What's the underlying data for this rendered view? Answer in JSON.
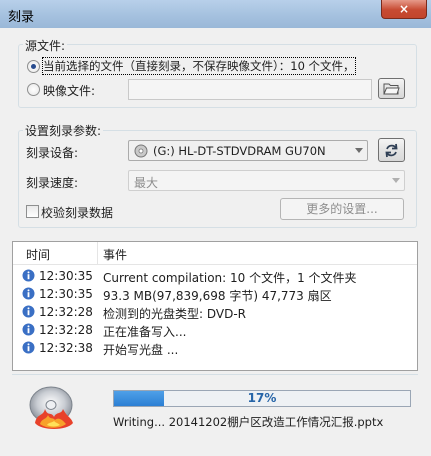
{
  "window": {
    "title": "刻录",
    "close_glyph": "×"
  },
  "source": {
    "group_label": "源文件:",
    "current_files_label": "当前选择的文件（直接刻录，不保存映像文件）：10 个文件，",
    "current_files_selected": true,
    "image_file_label": "映像文件:",
    "image_file_value": ""
  },
  "burn_settings": {
    "group_label": "设置刻录参数:",
    "device_label": "刻录设备:",
    "device_value": "(G:) HL-DT-STDVDRAM GU70N",
    "speed_label": "刻录速度:",
    "speed_value": "最大",
    "verify_label": "校验刻录数据",
    "verify_checked": false,
    "more_settings_label": "更多的设置..."
  },
  "log": {
    "columns": [
      "时间",
      "事件"
    ],
    "rows": [
      {
        "time": "12:30:35",
        "event": "Current compilation: 10 个文件，1 个文件夹"
      },
      {
        "time": "12:30:35",
        "event": "93.3 MB(97,839,698 字节)  47,773 扇区"
      },
      {
        "time": "12:32:28",
        "event": "检测到的光盘类型:  DVD-R"
      },
      {
        "time": "12:32:28",
        "event": "正在准备写入..."
      },
      {
        "time": "12:32:38",
        "event": "开始写光盘 ..."
      }
    ]
  },
  "progress": {
    "percent": 17,
    "label": "17%"
  },
  "status": {
    "text": "Writing... 20141202棚户区改造工作情况汇报.pptx"
  },
  "colors": {
    "accent": "#2b7fd4",
    "info_icon": "#3a6fc4"
  }
}
